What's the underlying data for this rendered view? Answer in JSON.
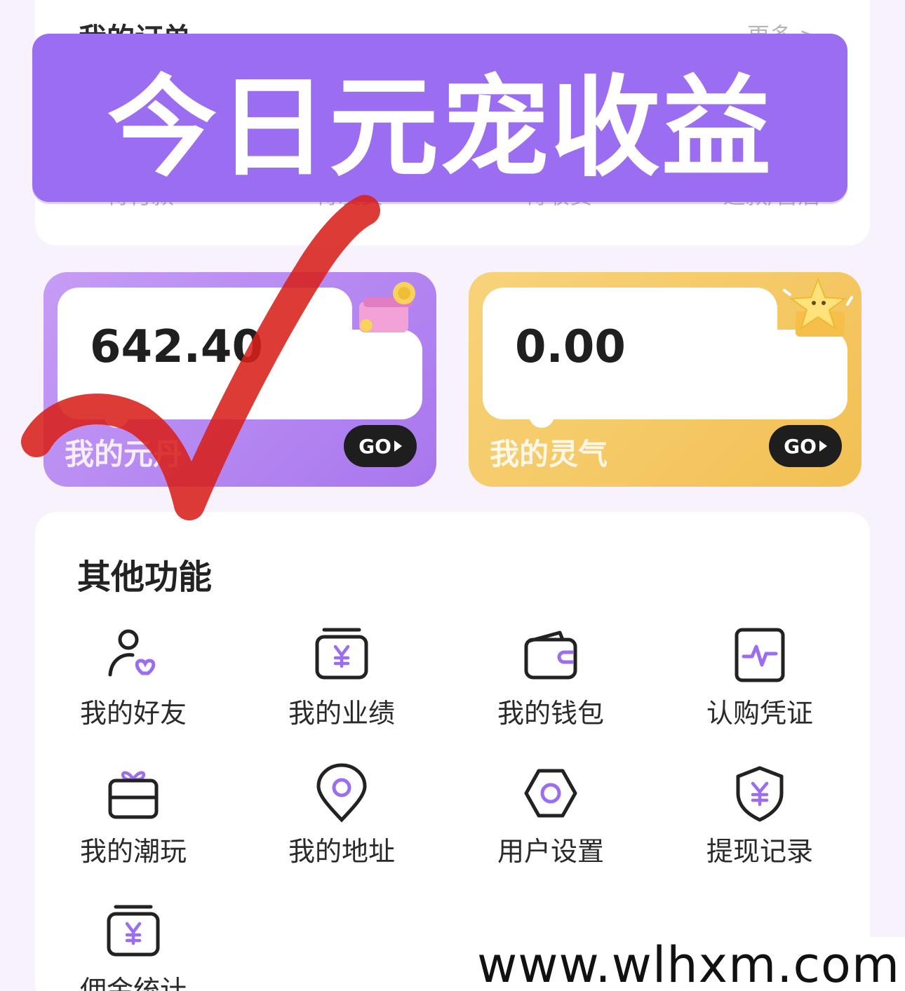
{
  "orders": {
    "title": "我的订单",
    "more": "更多 >",
    "tabs": [
      "待付款",
      "待发货",
      "待收货",
      "退款/售后"
    ]
  },
  "banner": {
    "text": "今日元宠收益"
  },
  "balances": [
    {
      "value": "642.40",
      "label": "我的元丹",
      "go": "GO",
      "color": "#a877ee"
    },
    {
      "value": "0.00",
      "label": "我的灵气",
      "go": "GO",
      "color": "#f2c054"
    }
  ],
  "functions": {
    "title": "其他功能",
    "items": [
      {
        "label": "我的好友",
        "icon": "friend-heart-icon"
      },
      {
        "label": "我的业绩",
        "icon": "yuan-box-icon"
      },
      {
        "label": "我的钱包",
        "icon": "wallet-icon"
      },
      {
        "label": "认购凭证",
        "icon": "pulse-certificate-icon"
      },
      {
        "label": "我的潮玩",
        "icon": "gift-box-icon"
      },
      {
        "label": "我的地址",
        "icon": "location-pin-icon"
      },
      {
        "label": "用户设置",
        "icon": "settings-hexagon-icon"
      },
      {
        "label": "提现记录",
        "icon": "yuan-shield-icon"
      },
      {
        "label": "佣金统计",
        "icon": "yuan-box-icon"
      }
    ]
  },
  "watermark": "www.wlhxm.com",
  "colors": {
    "accent": "#9b6df0",
    "gold": "#f2c054",
    "check": "#d8201a"
  }
}
